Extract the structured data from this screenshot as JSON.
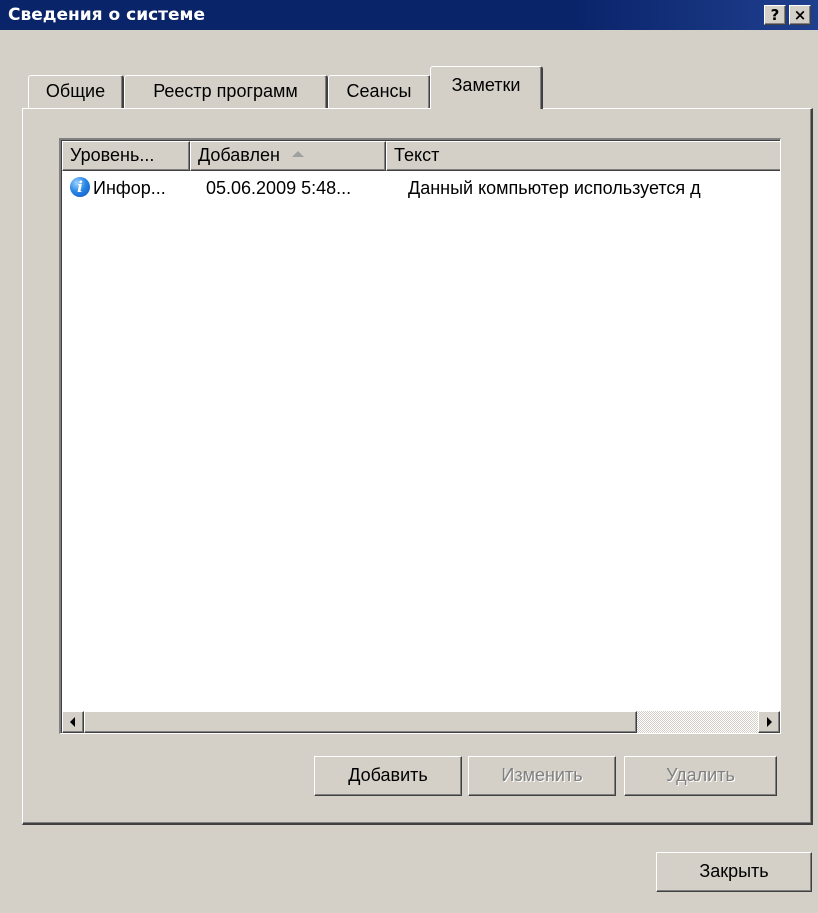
{
  "window": {
    "title": "Сведения о системе",
    "help_button": "?",
    "close_button": "×"
  },
  "tabs": [
    {
      "label": "Общие",
      "selected": false
    },
    {
      "label": "Реестр программ",
      "selected": false
    },
    {
      "label": "Сеансы",
      "selected": false
    },
    {
      "label": "Заметки",
      "selected": true
    }
  ],
  "notes_list": {
    "columns": [
      {
        "label": "Уровень..."
      },
      {
        "label": "Добавлен",
        "sorted": "ascending"
      },
      {
        "label": "Текст"
      }
    ],
    "rows": [
      {
        "level_icon": "info-icon",
        "level": "Инфор...",
        "added": "05.06.2009 5:48...",
        "text": "Данный компьютер используется д"
      }
    ],
    "horizontal_scroll_position": 0.0
  },
  "actions": {
    "add_label": "Добавить",
    "edit_label": "Изменить",
    "edit_enabled": false,
    "delete_label": "Удалить",
    "delete_enabled": false
  },
  "footer": {
    "close_label": "Закрыть"
  },
  "colors": {
    "titlebar": "#0a246a",
    "face": "#d4d0c8",
    "disabled_text": "#808080"
  }
}
